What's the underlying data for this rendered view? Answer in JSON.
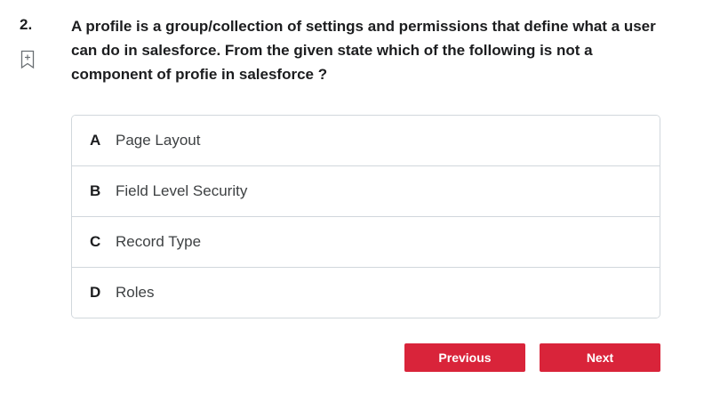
{
  "question": {
    "number": "2.",
    "text": "A profile is a group/collection of settings and permissions that define what a user can do in salesforce. From the given state which of the following is not a component of profie in salesforce ?"
  },
  "options": [
    {
      "letter": "A",
      "label": "Page Layout"
    },
    {
      "letter": "B",
      "label": "Field Level Security"
    },
    {
      "letter": "C",
      "label": "Record Type"
    },
    {
      "letter": "D",
      "label": "Roles"
    }
  ],
  "navigation": {
    "previous_label": "Previous",
    "next_label": "Next"
  },
  "icons": {
    "bookmark": "bookmark-plus-icon"
  },
  "colors": {
    "accent": "#d9243a",
    "border": "#d1d7dc",
    "text": "#1c1d1f"
  }
}
